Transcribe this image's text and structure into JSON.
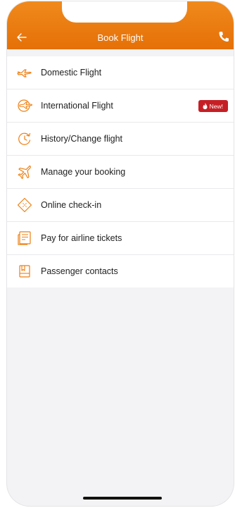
{
  "header": {
    "title": "Book Flight"
  },
  "menu": {
    "items": [
      {
        "label": "Domestic Flight",
        "icon": "domestic-plane-icon"
      },
      {
        "label": "International Flight",
        "icon": "globe-plane-icon",
        "badge": "New!"
      },
      {
        "label": "History/Change flight",
        "icon": "clock-history-icon"
      },
      {
        "label": "Manage your booking",
        "icon": "airplane-icon"
      },
      {
        "label": "Online check-in",
        "icon": "ticket-icon"
      },
      {
        "label": "Pay for airline tickets",
        "icon": "bill-icon"
      },
      {
        "label": "Passenger contacts",
        "icon": "contact-book-icon"
      }
    ]
  },
  "colors": {
    "accent": "#ee7f12",
    "badge": "#c51f25"
  }
}
